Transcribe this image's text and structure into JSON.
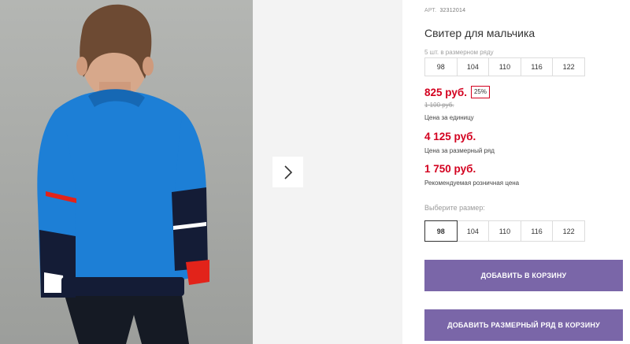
{
  "gallery": {
    "photo_subject": "boy in blue sweater, back view",
    "next_icon": "chevron-right-icon",
    "colors": {
      "sweater": "#1d7fd6",
      "sweater_dark": "#1668b4",
      "navy": "#141c36",
      "stripe_red": "#e2231a",
      "background": "#a9aba8"
    }
  },
  "product": {
    "sku_label": "АРТ.",
    "sku_value": "32312014",
    "title": "Свитер для мальчика",
    "pack_label": "5 шт. в размерном ряду",
    "pack_sizes": [
      "98",
      "104",
      "110",
      "116",
      "122"
    ],
    "price_unit": "825 руб.",
    "discount": "25%",
    "old_price": "1 100 руб.",
    "price_unit_caption": "Цена за единицу",
    "price_pack": "4 125 руб.",
    "price_pack_caption": "Цена за размерный ряд",
    "price_rrp": "1 750 руб.",
    "price_rrp_caption": "Рекомендуемая розничная цена",
    "choose_size_label": "Выберите размер:",
    "select_sizes": [
      "98",
      "104",
      "110",
      "116",
      "122"
    ],
    "selected_size": "98",
    "add_to_cart_label": "ДОБАВИТЬ В КОРЗИНУ",
    "add_pack_to_cart_label": "ДОБАВИТЬ РАЗМЕРНЫЙ РЯД В КОРЗИНУ"
  },
  "colors": {
    "accent_price": "#d3001f",
    "button": "#7a66a8"
  }
}
